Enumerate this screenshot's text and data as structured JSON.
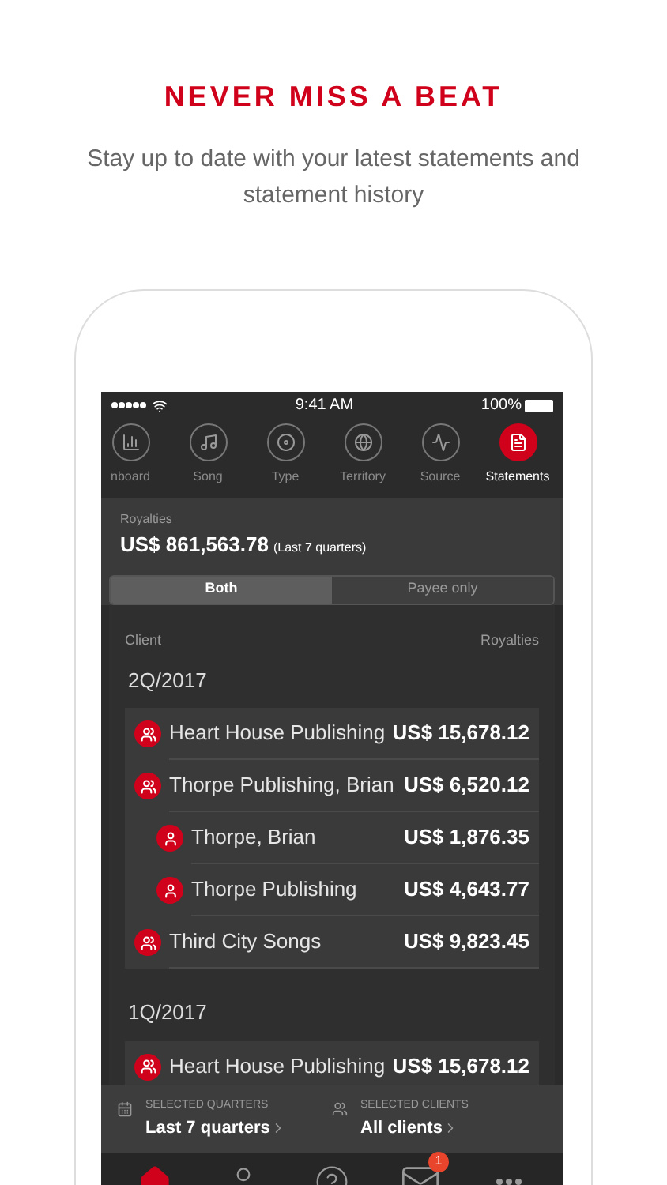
{
  "header": {
    "title": "NEVER MISS A BEAT",
    "subtitle": "Stay up to date with your latest statements and statement history"
  },
  "status_bar": {
    "time": "9:41 AM",
    "battery": "100%"
  },
  "tabs": [
    {
      "kind": "chart",
      "label": "nboard",
      "selected": false
    },
    {
      "kind": "song",
      "label": "Song",
      "selected": false
    },
    {
      "kind": "type",
      "label": "Type",
      "selected": false
    },
    {
      "kind": "territory",
      "label": "Territory",
      "selected": false
    },
    {
      "kind": "source",
      "label": "Source",
      "selected": false
    },
    {
      "kind": "statements",
      "label": "Statements",
      "selected": true
    }
  ],
  "summary": {
    "label": "Royalties",
    "amount": "US$ 861,563.78",
    "period": "(Last 7 quarters)"
  },
  "segments": [
    {
      "label": "Both",
      "selected": true
    },
    {
      "label": "Payee only",
      "selected": false
    }
  ],
  "list": {
    "columns": [
      "Client",
      "Royalties"
    ],
    "groups": [
      {
        "period": "2Q/2017",
        "rows": [
          {
            "kind": "group",
            "name": "Heart House Publishing",
            "amount": "US$ 15,678.12"
          },
          {
            "kind": "group",
            "name": "Thorpe Publishing, Brian",
            "amount": "US$ 6,520.12",
            "children": [
              {
                "kind": "person",
                "name": "Thorpe, Brian",
                "amount": "US$ 1,876.35"
              },
              {
                "kind": "person",
                "name": "Thorpe Publishing",
                "amount": "US$ 4,643.77"
              }
            ]
          },
          {
            "kind": "group",
            "name": "Third City Songs",
            "amount": "US$ 9,823.45"
          }
        ]
      },
      {
        "period": "1Q/2017",
        "rows": [
          {
            "kind": "group",
            "name": "Heart House Publishing",
            "amount": "US$ 15,678.12"
          }
        ]
      }
    ]
  },
  "filters": [
    {
      "kind": "calendar",
      "label": "SELECTED QUARTERS",
      "value": "Last 7 quarters"
    },
    {
      "kind": "clients",
      "label": "SELECTED CLIENTS",
      "value": "All clients"
    }
  ],
  "tab_bar": [
    {
      "kind": "home",
      "selected": true
    },
    {
      "kind": "person",
      "selected": false
    },
    {
      "kind": "help",
      "selected": false
    },
    {
      "kind": "mail",
      "selected": false,
      "badge": "1"
    },
    {
      "kind": "more",
      "selected": false
    }
  ]
}
